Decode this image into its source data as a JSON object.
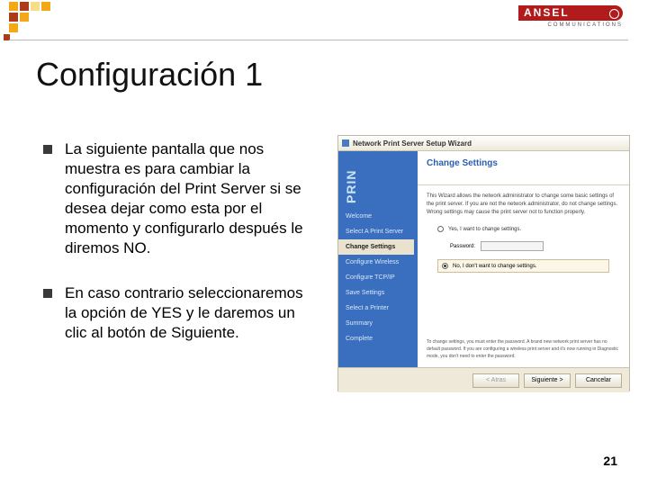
{
  "brand": {
    "name": "ANSEL",
    "sub": "COMMUNICATIONS"
  },
  "logo_colors": [
    "#f2a817",
    "#f2a817",
    "#ad3a1b",
    "#f6dd87",
    "#ad3a1b",
    "#f2a817",
    "#ad3a1b",
    "#f2a817",
    "#ad3a1b"
  ],
  "title": "Configuración 1",
  "bullets": [
    "La siguiente pantalla que nos muestra es para cambiar la configuración del Print Server si se desea dejar como esta por el momento y configurarlo después le diremos NO.",
    "En caso contrario seleccionaremos la opción de YES y le daremos un clic al botón de Siguiente."
  ],
  "wizard": {
    "window_title": "Network Print Server Setup Wizard",
    "side_brand": "PRIN",
    "steps": [
      "Welcome",
      "Select A Print Server",
      "Change Settings",
      "Configure Wireless",
      "Configure TCP/IP",
      "Save Settings",
      "Select a Printer",
      "Summary",
      "Complete"
    ],
    "active_step_index": 2,
    "header": "Change Settings",
    "description": "This Wizard allows the network administrator to change some basic settings of the print server. If you are not the network administrator, do not change settings. Wrong settings may cause the print server not to function properly.",
    "option_yes": "Yes, I want to change settings.",
    "password_label": "Password:",
    "option_no": "No, I don't want to change settings.",
    "selected": "no",
    "note": "To change settings, you must enter the password. A brand new network print server has no default password. If you are configuring a wireless print server and it's now running in Diagnostic mode, you don't need to enter the password.",
    "buttons": {
      "back": "< Atras",
      "next": "Siguiente >",
      "cancel": "Cancelar"
    }
  },
  "page_number": "21"
}
